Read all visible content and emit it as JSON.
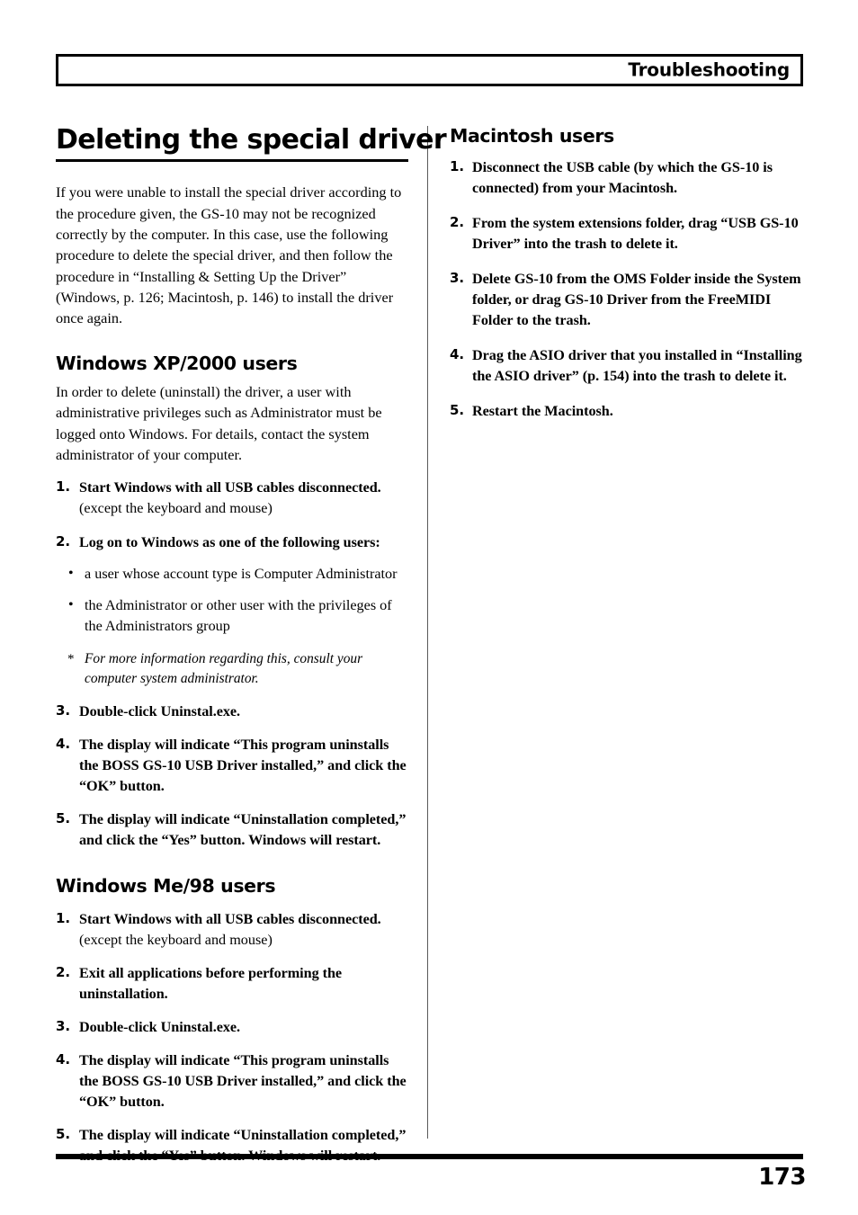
{
  "header": {
    "title": "Troubleshooting"
  },
  "left_column": {
    "heading": "Deleting the special driver",
    "intro": "If you were unable to install the special driver according to the procedure given, the GS-10 may not be recognized correctly by the computer. In this case, use the following procedure to delete the special driver, and then follow the procedure in “Installing & Setting Up the Driver” (Windows, p. 126; Macintosh, p. 146) to install the driver once again.",
    "xp2000": {
      "heading": "Windows XP/2000 users",
      "intro": "In order to delete (uninstall) the driver, a user with administrative privileges such as Administrator must be logged onto Windows. For details, contact the system administrator of your computer.",
      "steps": [
        {
          "num": "1.",
          "text": "Start Windows with all USB cables disconnected.",
          "sub": "(except the keyboard and mouse)"
        },
        {
          "num": "2.",
          "text": "Log on to Windows as one of the following users:"
        },
        {
          "num": "3.",
          "text": "Double-click Uninstal.exe."
        },
        {
          "num": "4.",
          "text": "The display will indicate “This program uninstalls the BOSS GS-10 USB Driver installed,” and click the “OK” button."
        },
        {
          "num": "5.",
          "text": "The display will indicate “Uninstallation completed,” and click the “Yes” button. Windows will restart."
        }
      ],
      "bullets": [
        "a user whose account type is Computer Administrator",
        "the Administrator or other user with the privileges of the Administrators group"
      ],
      "footnote": {
        "mark": "*",
        "text": "For more information regarding this, consult your computer system administrator."
      }
    },
    "me98": {
      "heading": "Windows Me/98 users",
      "steps": [
        {
          "num": "1.",
          "text": "Start Windows with all USB cables disconnected.",
          "sub": "(except the keyboard and mouse)"
        },
        {
          "num": "2.",
          "text": "Exit all applications before performing the uninstallation."
        },
        {
          "num": "3.",
          "text": "Double-click Uninstal.exe."
        },
        {
          "num": "4.",
          "text": "The display will indicate “This program uninstalls the BOSS GS-10 USB Driver installed,” and click the “OK” button."
        },
        {
          "num": "5.",
          "text": "The display will indicate “Uninstallation completed,” and click the “Yes” button. Windows will restart."
        }
      ]
    }
  },
  "right_column": {
    "macintosh": {
      "heading": "Macintosh users",
      "steps": [
        {
          "num": "1.",
          "text": "Disconnect the USB cable (by which the GS-10 is connected) from your Macintosh."
        },
        {
          "num": "2.",
          "text": "From the system extensions folder, drag “USB GS-10 Driver” into the trash to delete it."
        },
        {
          "num": "3.",
          "text": "Delete GS-10 from the OMS Folder inside the System folder, or drag GS-10 Driver from the FreeMIDI Folder to the trash."
        },
        {
          "num": "4.",
          "text": "Drag the ASIO driver that you installed in “Installing the ASIO driver” (p. 154) into the trash to delete it."
        },
        {
          "num": "5.",
          "text": "Restart the Macintosh."
        }
      ]
    }
  },
  "footer": {
    "page_number": "173"
  }
}
